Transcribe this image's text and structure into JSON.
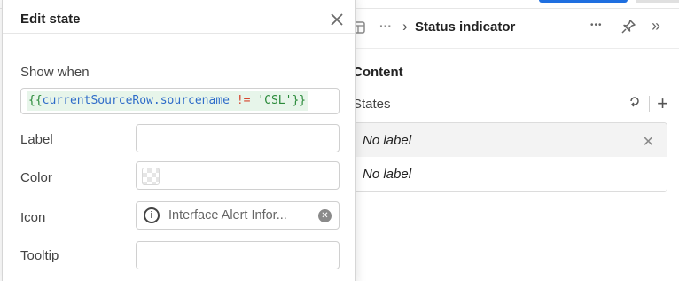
{
  "inspector": {
    "header": {
      "table_icon": "table-icon",
      "more_label": "···",
      "chevron": "›",
      "title": "Status indicator",
      "kebab_label": "•••",
      "pin_icon": "pin-icon",
      "collapse_label": "»"
    },
    "content_title": "Content",
    "states": {
      "label": "States",
      "link_icon": "link-icon",
      "add_label": "+",
      "items": [
        {
          "label": "No label",
          "active": true
        },
        {
          "label": "No label",
          "active": false
        }
      ],
      "close_label": "✕"
    }
  },
  "popover": {
    "title": "Edit state",
    "close_label": "✕",
    "show_when": {
      "label": "Show when",
      "expr_open": "{{",
      "expr_var": "currentSourceRow",
      "expr_dot": ".",
      "expr_field": "sourcename",
      "expr_op": " != ",
      "expr_str": "'CSL'",
      "expr_close": "}}"
    },
    "fields": {
      "label": {
        "label": "Label",
        "value": ""
      },
      "color": {
        "label": "Color",
        "value": ""
      },
      "icon": {
        "label": "Icon",
        "value": "Interface Alert Infor...",
        "icon": "info-icon"
      },
      "tooltip": {
        "label": "Tooltip",
        "value": ""
      }
    }
  },
  "colors": {
    "accent": "#1f6fe0",
    "code_bg": "#e7f5ea"
  }
}
